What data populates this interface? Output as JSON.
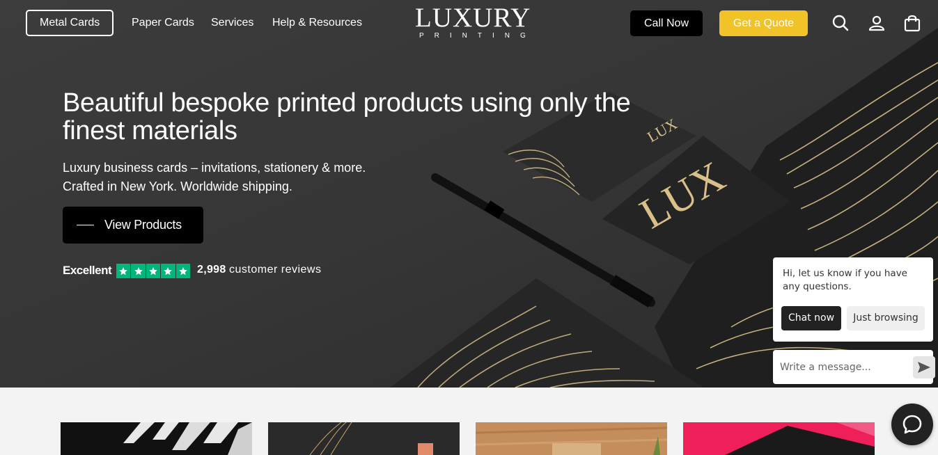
{
  "nav": {
    "links": [
      {
        "label": "Metal Cards"
      },
      {
        "label": "Paper Cards"
      },
      {
        "label": "Services"
      },
      {
        "label": "Help & Resources"
      }
    ],
    "logo_main": "LUXURY",
    "logo_sub": "PRINTING",
    "call_label": "Call Now",
    "quote_label": "Get a Quote",
    "icons": [
      "search-icon",
      "account-icon",
      "bag-icon"
    ]
  },
  "hero": {
    "title": "Beautiful bespoke printed products using only the finest materials",
    "subtitle_line1": "Luxury business cards – invitations, stationery & more.",
    "subtitle_line2": "Crafted in New York. Worldwide shipping.",
    "cta_label": "View Products"
  },
  "reviews": {
    "rating_text": "Excellent",
    "stars": 5,
    "count": "2,998",
    "count_label": "customer reviews"
  },
  "chat": {
    "message": "Hi, let us know if you have any questions.",
    "chat_now_label": "Chat now",
    "browsing_label": "Just browsing",
    "input_placeholder": "Write a message..."
  },
  "colors": {
    "hero_bg": "#3a3a3a",
    "quote_yellow": "#f2c229",
    "trustpilot_green": "#00b67a",
    "gold": "#d9c08a"
  }
}
